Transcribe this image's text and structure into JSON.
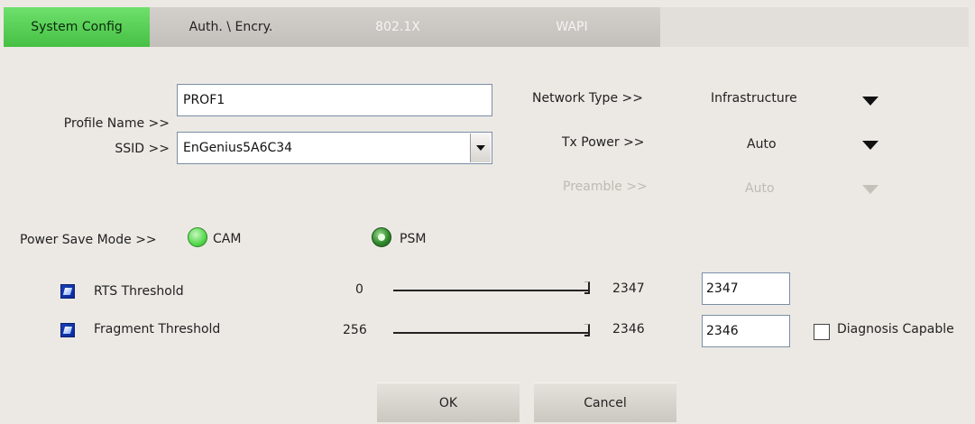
{
  "tabs": [
    {
      "label": "System Config",
      "state": "active"
    },
    {
      "label": "Auth. \\ Encry.",
      "state": "normal"
    },
    {
      "label": "802.1X",
      "state": "disabled"
    },
    {
      "label": "WAPI",
      "state": "disabled"
    }
  ],
  "profile": {
    "label": "Profile Name >>",
    "value": "PROF1"
  },
  "ssid": {
    "label": "SSID >>",
    "value": "EnGenius5A6C34"
  },
  "network_type": {
    "label": "Network Type >>",
    "value": "Infrastructure"
  },
  "tx_power": {
    "label": "Tx Power >>",
    "value": "Auto"
  },
  "preamble": {
    "label": "Preamble >>",
    "value": "Auto"
  },
  "power_save": {
    "label": "Power Save Mode >>",
    "options": [
      {
        "label": "CAM",
        "selected": false
      },
      {
        "label": "PSM",
        "selected": true
      }
    ]
  },
  "rts": {
    "label": "RTS Threshold",
    "checked": true,
    "min": "0",
    "max": "2347",
    "value": "2347",
    "slider_fraction": 1.0
  },
  "fragment": {
    "label": "Fragment Threshold",
    "checked": true,
    "min": "256",
    "max": "2346",
    "value": "2346",
    "slider_fraction": 1.0
  },
  "diagnosis": {
    "label": "Diagnosis Capable",
    "checked": false
  },
  "buttons": {
    "ok": "OK",
    "cancel": "Cancel"
  },
  "colors": {
    "active_tab": "#46c044",
    "panel_bg": "#ece9e4",
    "checkbox_blue": "#0a2a9a"
  }
}
